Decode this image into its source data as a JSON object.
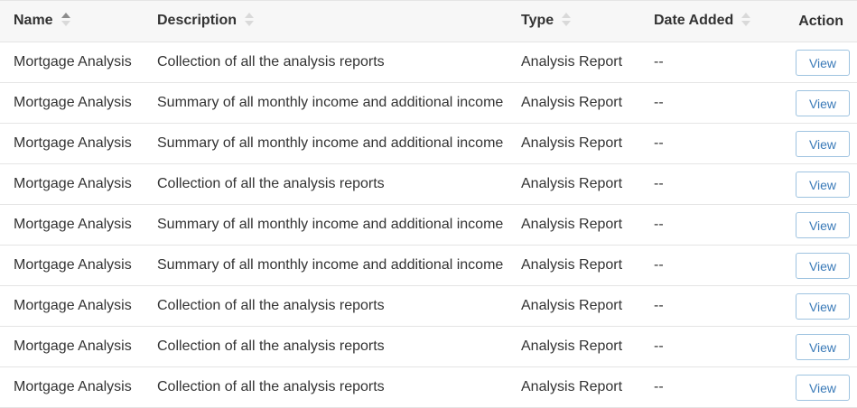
{
  "table": {
    "columns": [
      {
        "key": "name",
        "label": "Name",
        "sort": "asc"
      },
      {
        "key": "description",
        "label": "Description",
        "sort": "none"
      },
      {
        "key": "type",
        "label": "Type",
        "sort": "none"
      },
      {
        "key": "date_added",
        "label": "Date Added",
        "sort": "none"
      },
      {
        "key": "action",
        "label": "Action"
      }
    ],
    "rows": [
      {
        "name": "Mortgage Analysis",
        "description": "Collection of all the analysis reports",
        "type": "Analysis Report",
        "date_added": "--",
        "action": "View"
      },
      {
        "name": "Mortgage Analysis",
        "description": "Summary of all monthly income and additional income",
        "type": "Analysis Report",
        "date_added": "--",
        "action": "View"
      },
      {
        "name": "Mortgage Analysis",
        "description": "Summary of all monthly income and additional income",
        "type": "Analysis Report",
        "date_added": "--",
        "action": "View"
      },
      {
        "name": "Mortgage Analysis",
        "description": "Collection of all the analysis reports",
        "type": "Analysis Report",
        "date_added": "--",
        "action": "View"
      },
      {
        "name": "Mortgage Analysis",
        "description": "Summary of all monthly income and additional income",
        "type": "Analysis Report",
        "date_added": "--",
        "action": "View"
      },
      {
        "name": "Mortgage Analysis",
        "description": "Summary of all monthly income and additional income",
        "type": "Analysis Report",
        "date_added": "--",
        "action": "View"
      },
      {
        "name": "Mortgage Analysis",
        "description": "Collection of all the analysis reports",
        "type": "Analysis Report",
        "date_added": "--",
        "action": "View"
      },
      {
        "name": "Mortgage Analysis",
        "description": "Collection of all the analysis reports",
        "type": "Analysis Report",
        "date_added": "--",
        "action": "View"
      },
      {
        "name": "Mortgage Analysis",
        "description": "Collection of all the analysis reports",
        "type": "Analysis Report",
        "date_added": "--",
        "action": "View"
      }
    ]
  },
  "colors": {
    "header_bg": "#f7f7f7",
    "border": "#e5e5e5",
    "button_text": "#3a7ab8",
    "button_border": "#9ec3e0",
    "sort_active": "#8c8c8c",
    "sort_inactive": "#d9d9d9"
  }
}
